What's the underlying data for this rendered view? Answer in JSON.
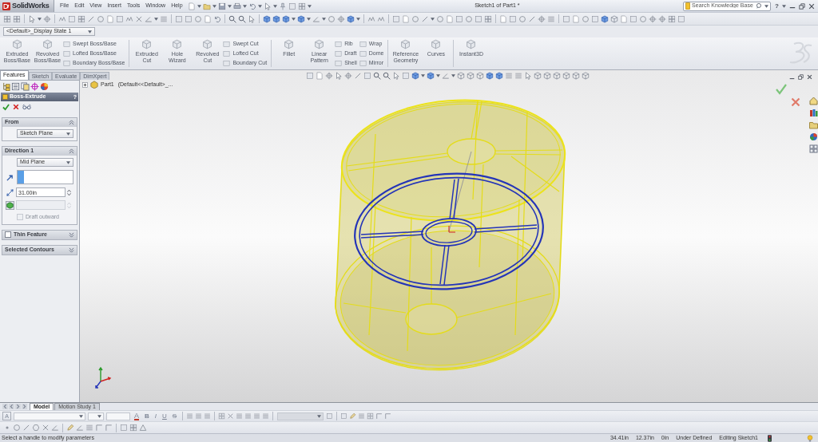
{
  "app_bar": {
    "logo": "SolidWorks",
    "menu": [
      "File",
      "Edit",
      "View",
      "Insert",
      "Tools",
      "Window",
      "Help"
    ],
    "title": "Sketch1 of Part1 *",
    "search": {
      "placeholder": "Search Knowledge Base"
    },
    "help": "?"
  },
  "display_state": {
    "value": "<Default>_Display State 1"
  },
  "ribbon": {
    "groups": [
      {
        "columns": [
          {
            "kind": "large",
            "label": "Extruded Boss/Base"
          },
          {
            "kind": "large",
            "label": "Revolved Boss/Base"
          },
          {
            "kind": "stack",
            "items": [
              "Swept Boss/Base",
              "Lofted Boss/Base",
              "Boundary Boss/Base"
            ]
          }
        ]
      },
      {
        "columns": [
          {
            "kind": "large",
            "label": "Extruded Cut"
          },
          {
            "kind": "large",
            "label": "Hole Wizard"
          },
          {
            "kind": "large",
            "label": "Revolved Cut"
          },
          {
            "kind": "stack",
            "items": [
              "Swept Cut",
              "Lofted Cut",
              "Boundary Cut"
            ]
          }
        ]
      },
      {
        "columns": [
          {
            "kind": "large",
            "label": "Fillet"
          },
          {
            "kind": "large",
            "label": "Linear Pattern"
          },
          {
            "kind": "stack",
            "items": [
              "Rib",
              "Draft",
              "Shell"
            ]
          },
          {
            "kind": "stack",
            "items": [
              "Wrap",
              "Dome",
              "Mirror"
            ]
          }
        ]
      },
      {
        "columns": [
          {
            "kind": "large",
            "label": "Reference Geometry"
          },
          {
            "kind": "large",
            "label": "Curves"
          }
        ]
      },
      {
        "columns": [
          {
            "kind": "large",
            "label": "Instant3D"
          }
        ]
      }
    ]
  },
  "manager_tabs": [
    {
      "label": "Features",
      "selected": true
    },
    {
      "label": "Sketch",
      "selected": false
    },
    {
      "label": "Evaluate",
      "selected": false
    },
    {
      "label": "DimXpert",
      "selected": false
    }
  ],
  "property_manager": {
    "title": "Boss-Extrude",
    "help": "?",
    "sections": [
      {
        "title": "From",
        "expanded": true,
        "fields": [
          {
            "kind": "dropdown",
            "value": "Sketch Plane"
          }
        ]
      },
      {
        "title": "Direction 1",
        "expanded": true,
        "fields": [
          {
            "kind": "dropdown",
            "value": "Mid Plane"
          },
          {
            "kind": "selection",
            "active": true
          },
          {
            "kind": "number",
            "value": "31.00in",
            "disabled": false
          },
          {
            "kind": "number",
            "disabled": true
          },
          {
            "kind": "checkbox",
            "label": "Draft outward",
            "checked": false,
            "disabled": true
          }
        ]
      },
      {
        "title": "Thin Feature",
        "expanded": false,
        "checkbox": {
          "checked": false
        }
      },
      {
        "title": "Selected Contours",
        "expanded": false
      }
    ]
  },
  "viewport": {
    "tree_item": {
      "name": "Part1",
      "config": "(Default<<Default>_..."
    }
  },
  "bottom_tabs": [
    {
      "label": "Model",
      "selected": true
    },
    {
      "label": "Motion Study 1",
      "selected": false
    }
  ],
  "format_toolbar": {
    "font_button": "A",
    "style_buttons": [
      {
        "kind": "color",
        "label": "A"
      },
      {
        "kind": "bold",
        "label": "B"
      },
      {
        "kind": "italic",
        "label": "I"
      },
      {
        "kind": "underline",
        "label": "U"
      },
      {
        "kind": "strike",
        "label": "S"
      }
    ]
  },
  "status_bar": {
    "message": "Select a handle to modify parameters",
    "fields": [
      "34.41in",
      "12.37in",
      "0in",
      "Under Defined",
      "Editing Sketch1"
    ]
  }
}
